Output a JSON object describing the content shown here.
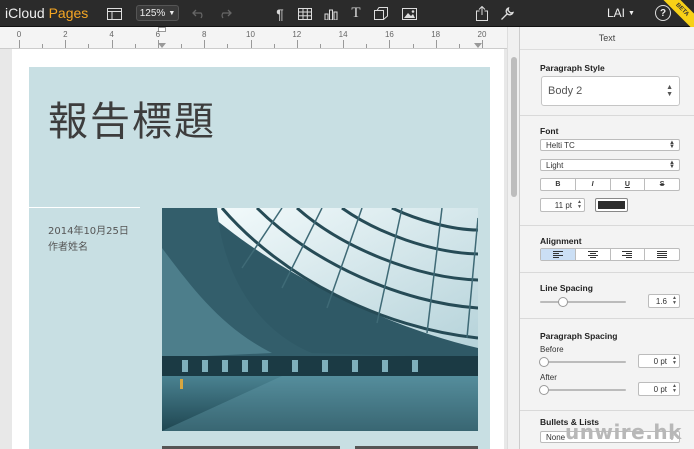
{
  "app": {
    "brand": "iCloud",
    "product": "Pages",
    "brand_color": "#f5a623"
  },
  "toolbar": {
    "zoom": "125%",
    "user": "LAI",
    "help": "?",
    "icons": [
      "sidebar-view-icon",
      "undo-icon",
      "redo-icon",
      "pilcrow-icon",
      "table-icon",
      "chart-icon",
      "text-box-icon",
      "shape-icon",
      "image-icon",
      "share-icon",
      "wrench-icon"
    ],
    "beta": "BETA"
  },
  "ruler": {
    "labels": [
      "0",
      "2",
      "4",
      "6",
      "8",
      "10",
      "12",
      "14",
      "16",
      "18",
      "20"
    ]
  },
  "document": {
    "title": "報告標題",
    "date": "2014年10月25日",
    "author": "作者姓名",
    "cover_color": "#c8dfe3"
  },
  "inspector": {
    "header": "Text",
    "paragraph_style": {
      "title": "Paragraph Style",
      "value": "Body 2"
    },
    "font": {
      "title": "Font",
      "family": "Helti TC",
      "weight": "Light",
      "buttons": [
        "B",
        "I",
        "U",
        "S"
      ],
      "size": "11 pt",
      "color": "#2d2d2d"
    },
    "alignment": {
      "title": "Alignment",
      "options": [
        "align-left-icon",
        "align-center-icon",
        "align-right-icon",
        "justify-icon"
      ],
      "selected": 0
    },
    "line_spacing": {
      "title": "Line Spacing",
      "value": "1.6",
      "level": 0.25
    },
    "paragraph_spacing": {
      "title": "Paragraph Spacing",
      "before_label": "Before",
      "before_value": "0 pt",
      "before_level": 0,
      "after_label": "After",
      "after_value": "0 pt",
      "after_level": 0
    },
    "bullets": {
      "title": "Bullets & Lists",
      "value": "None"
    }
  },
  "watermark": "unwire.hk"
}
